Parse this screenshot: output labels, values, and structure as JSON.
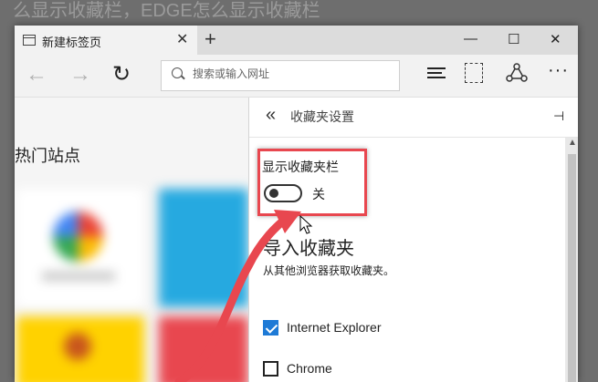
{
  "background_title": "么显示收藏栏，EDGE怎么显示收藏栏",
  "tab": {
    "label": "新建标签页",
    "close": "✕",
    "new_tab": "+"
  },
  "window_controls": {
    "minimize": "—",
    "maximize": "☐",
    "close": "✕"
  },
  "toolbar": {
    "back": "←",
    "forward": "→",
    "refresh": "↻",
    "address_placeholder": "搜索或输入网址",
    "more": "···"
  },
  "page": {
    "top_sites_heading": "热门站点"
  },
  "favorites_panel": {
    "back": "«",
    "title": "收藏夹设置",
    "pin": "⊣",
    "show_bar_label": "显示收藏夹栏",
    "show_bar_state": "关",
    "show_bar_on": false,
    "import_heading": "导入收藏夹",
    "import_subtitle": "从其他浏览器获取收藏夹。",
    "browsers": [
      {
        "label": "Internet Explorer",
        "checked": true
      },
      {
        "label": "Chrome",
        "checked": false
      }
    ]
  },
  "colors": {
    "annotation_red": "#e8474f",
    "checkbox_blue": "#1e7ad6",
    "tile_yellow": "#ffd200",
    "tile_blue": "#26a9e0",
    "tile_red": "#e8474f"
  }
}
